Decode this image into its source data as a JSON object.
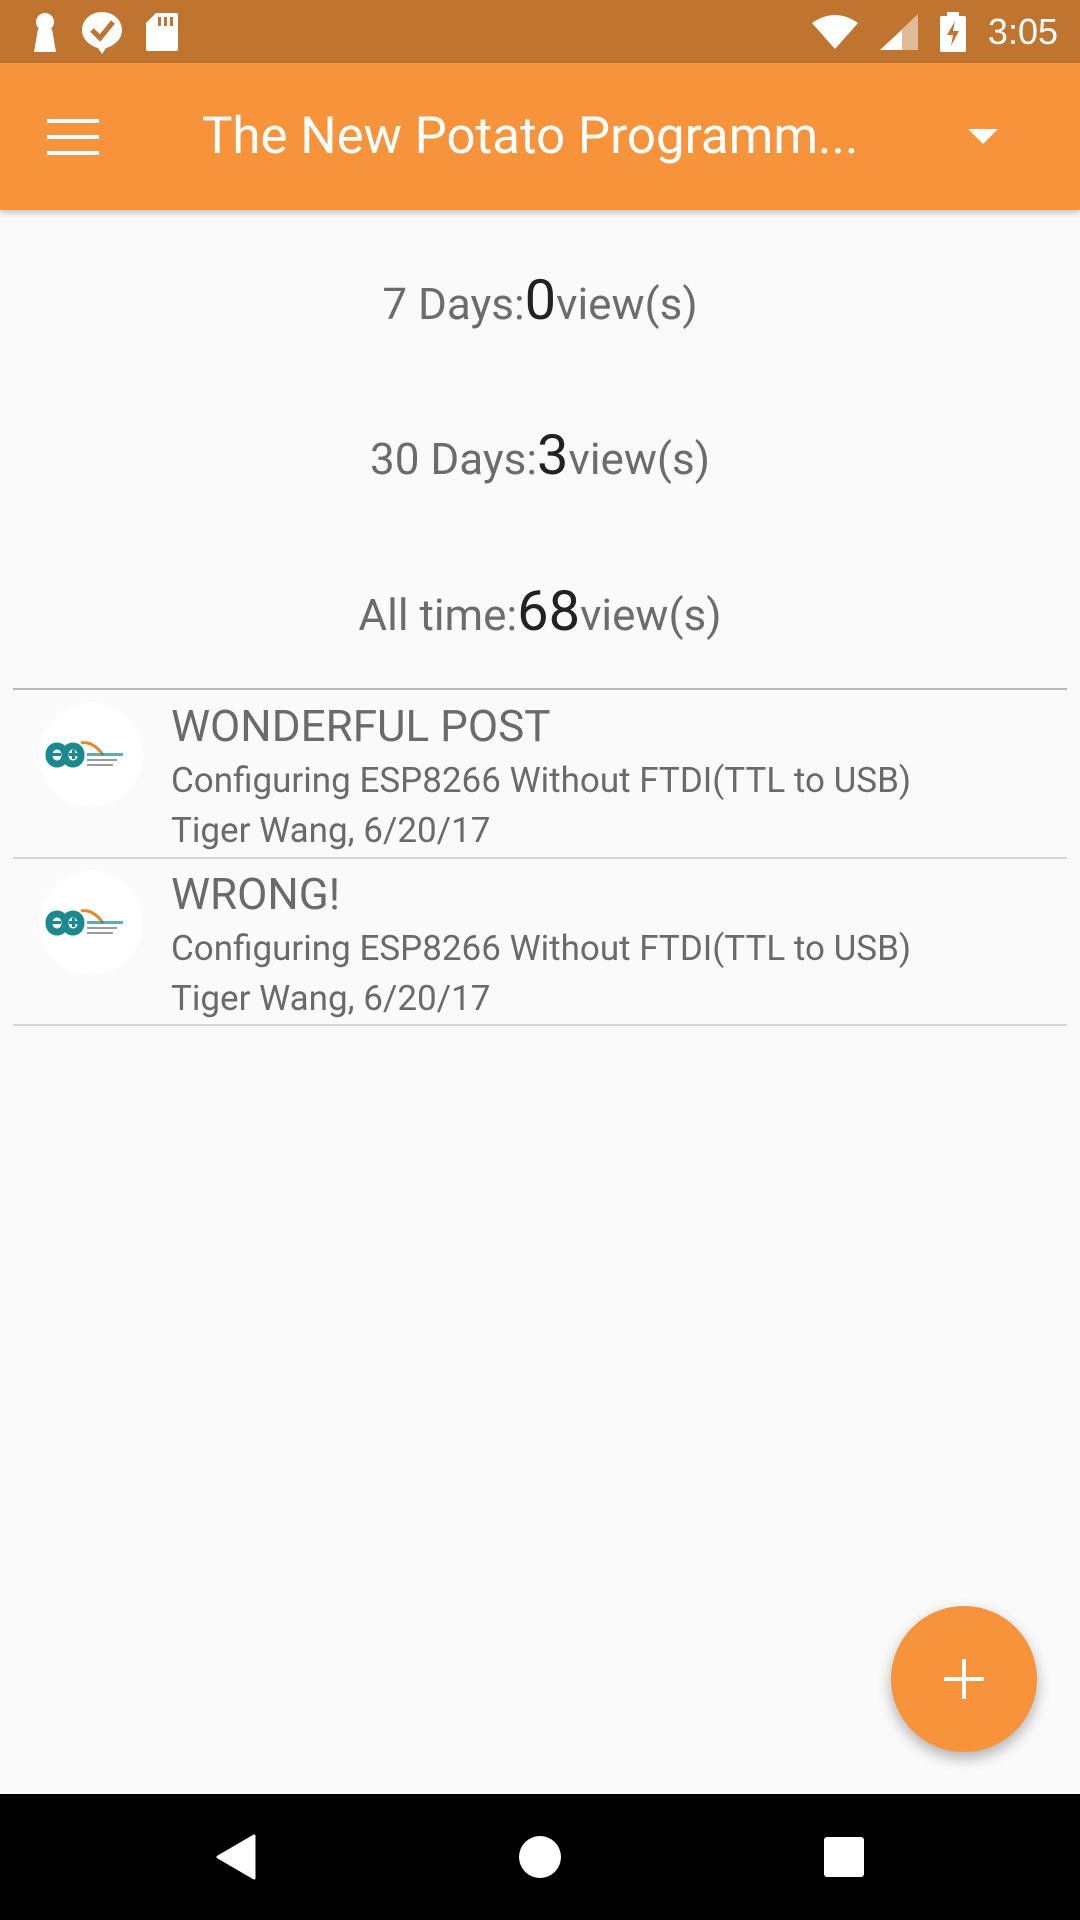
{
  "status_bar": {
    "time": "3:05",
    "icons_left": [
      "keyhole-icon",
      "checkmark-badge-icon",
      "sd-card-icon"
    ],
    "icons_right": [
      "wifi-icon",
      "cell-signal-icon",
      "battery-charging-icon"
    ]
  },
  "toolbar": {
    "title": "The New Potato Programm...",
    "menu_icon": "hamburger-menu-icon",
    "dropdown_icon": "dropdown-arrow-icon",
    "background": "#f7933a"
  },
  "stats": [
    {
      "label": "7 Days:",
      "value": "0",
      "unit": "view(s)"
    },
    {
      "label": "30 Days:",
      "value": "3",
      "unit": "view(s)"
    },
    {
      "label": "All time:",
      "value": "68",
      "unit": "view(s)"
    }
  ],
  "comments": [
    {
      "title": "WONDERFUL POST",
      "post": "Configuring ESP8266 Without FTDI(TTL to USB)",
      "meta": "Tiger Wang, 6/20/17",
      "avatar_icon": "arduino-logo-icon"
    },
    {
      "title": "WRONG!",
      "post": "Configuring ESP8266 Without FTDI(TTL to USB)",
      "meta": "Tiger Wang, 6/20/17",
      "avatar_icon": "arduino-logo-icon"
    }
  ],
  "fab": {
    "icon": "plus-icon",
    "color": "#f7933a"
  },
  "nav_bar": {
    "icons": [
      "back-icon",
      "home-icon",
      "recents-icon"
    ]
  }
}
